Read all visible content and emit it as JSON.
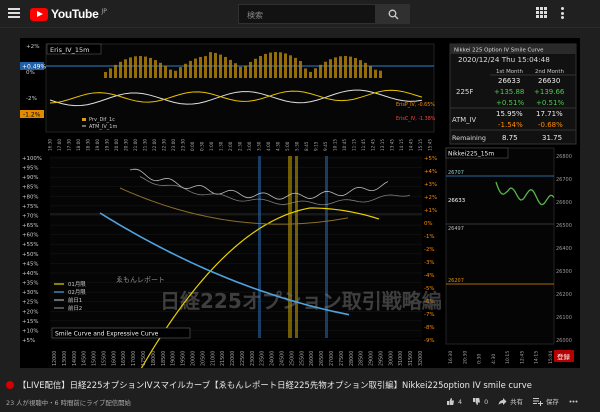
{
  "header": {
    "logo_text": "YouTube",
    "logo_region": "JP",
    "search_placeholder": "検索"
  },
  "video": {
    "title": "【LIVE配信】日経225オプションIVスマイルカーブ【ゑもんレポート日経225先物オプション取引編】Nikkei225option IV smile curve",
    "viewers": "23 人が視聴中・6 時間前にライブ配信開始",
    "likes": "4",
    "dislikes": "0",
    "share_label": "共有",
    "save_label": "保存"
  },
  "overlay": {
    "watermark": "日経225オプション取引戦略編",
    "watermark_top": "ゑもんレポート",
    "live_stamp": "登録"
  },
  "eris_chart": {
    "title": "Eris_IV_15m",
    "ytick_labels": [
      "+2%",
      "0%",
      "-2%"
    ],
    "left_badges": [
      "+0.49%",
      "-1.2%"
    ],
    "right_labels": [
      "ErisP_IV, -0.65%",
      "ErisC_IV, -1.38%"
    ],
    "legend": [
      "Prv_Dif_1c",
      "ATM_IV_1m"
    ],
    "xticks": [
      "16:30",
      "17:00",
      "17:30",
      "18:00",
      "18:30",
      "19:00",
      "19:30",
      "20:00",
      "20:30",
      "21:00",
      "21:30",
      "22:00",
      "22:30",
      "23:00",
      "23:30",
      "0:00",
      "0:30",
      "1:00",
      "1:30",
      "2:00",
      "2:30",
      "3:00",
      "3:30",
      "4:00",
      "4:30",
      "5:00",
      "5:30",
      "8:45",
      "9:15",
      "9:45",
      "10:15",
      "10:45",
      "11:15",
      "11:45",
      "12:45",
      "13:15",
      "13:45",
      "14:15",
      "14:45",
      "15:15",
      "15:45"
    ]
  },
  "iv_table": {
    "title": "Nikkei 225 Option IV Smile Curve",
    "datetime": "2020/12/24 Thu 15:04:48",
    "col_headers": [
      "1st Month",
      "2nd Month"
    ],
    "row_225f_label": "225F",
    "row_225f_values": [
      "26633",
      "26630"
    ],
    "row_change_values": [
      "+135.88",
      "+139.66"
    ],
    "row_pct_values": [
      "+0.51%",
      "+0.51%"
    ],
    "row_atm_label": "ATM_IV",
    "row_atm_values": [
      "15.95%",
      "17.71%"
    ],
    "row_atm_change": [
      "-1.54%",
      "-0.68%"
    ],
    "row_remaining_label": "Remaining",
    "row_remaining_values": [
      "8.75",
      "31.75"
    ]
  },
  "nikkei_chart": {
    "title": "Nikkei225_15m",
    "yticks": [
      "26800",
      "26700",
      "26600",
      "26500",
      "26400",
      "26300",
      "26200",
      "26100",
      "26000"
    ],
    "level_labels": [
      "26707",
      "26633",
      "26497",
      "26207"
    ],
    "xticks": [
      "16:30",
      "20:30",
      "0:30",
      "4:30",
      "10:15",
      "12:45",
      "14:15",
      "15:04"
    ]
  },
  "smile_chart": {
    "caption": "Smile Curve and Expressive Curve",
    "left_yticks": [
      "+100%",
      "+95%",
      "+90%",
      "+85%",
      "+80%",
      "+75%",
      "+70%",
      "+65%",
      "+60%",
      "+55%",
      "+50%",
      "+45%",
      "+40%",
      "+35%",
      "+30%",
      "+25%",
      "+20%",
      "+15%",
      "+10%",
      "+5%"
    ],
    "right_yticks": [
      "+5%",
      "+4%",
      "+3%",
      "+2%",
      "+1%",
      "0%",
      "-1%",
      "-2%",
      "-3%",
      "-4%",
      "-5%",
      "-6%",
      "-7%",
      "-8%",
      "-9%"
    ],
    "xticks": [
      "12000",
      "13000",
      "14000",
      "14500",
      "15000",
      "15500",
      "16000",
      "16500",
      "17000",
      "17500",
      "18000",
      "18500",
      "19000",
      "19500",
      "20000",
      "20500",
      "21000",
      "21500",
      "22000",
      "22500",
      "23000",
      "23500",
      "24000",
      "24500",
      "25000",
      "25500",
      "26000",
      "26500",
      "27000",
      "27500",
      "28000",
      "28500",
      "29000",
      "29500",
      "30000",
      "31000",
      "31500",
      "32000"
    ],
    "legend": [
      "01月限",
      "02月限",
      "前日1",
      "前日2"
    ]
  },
  "colors": {
    "accent_red": "#ff0000",
    "gold": "#d4a017",
    "cyan": "#3fa7d6",
    "green_text": "#4ec94e",
    "red_text": "#ff4040",
    "orange_text": "#ff8c00"
  }
}
